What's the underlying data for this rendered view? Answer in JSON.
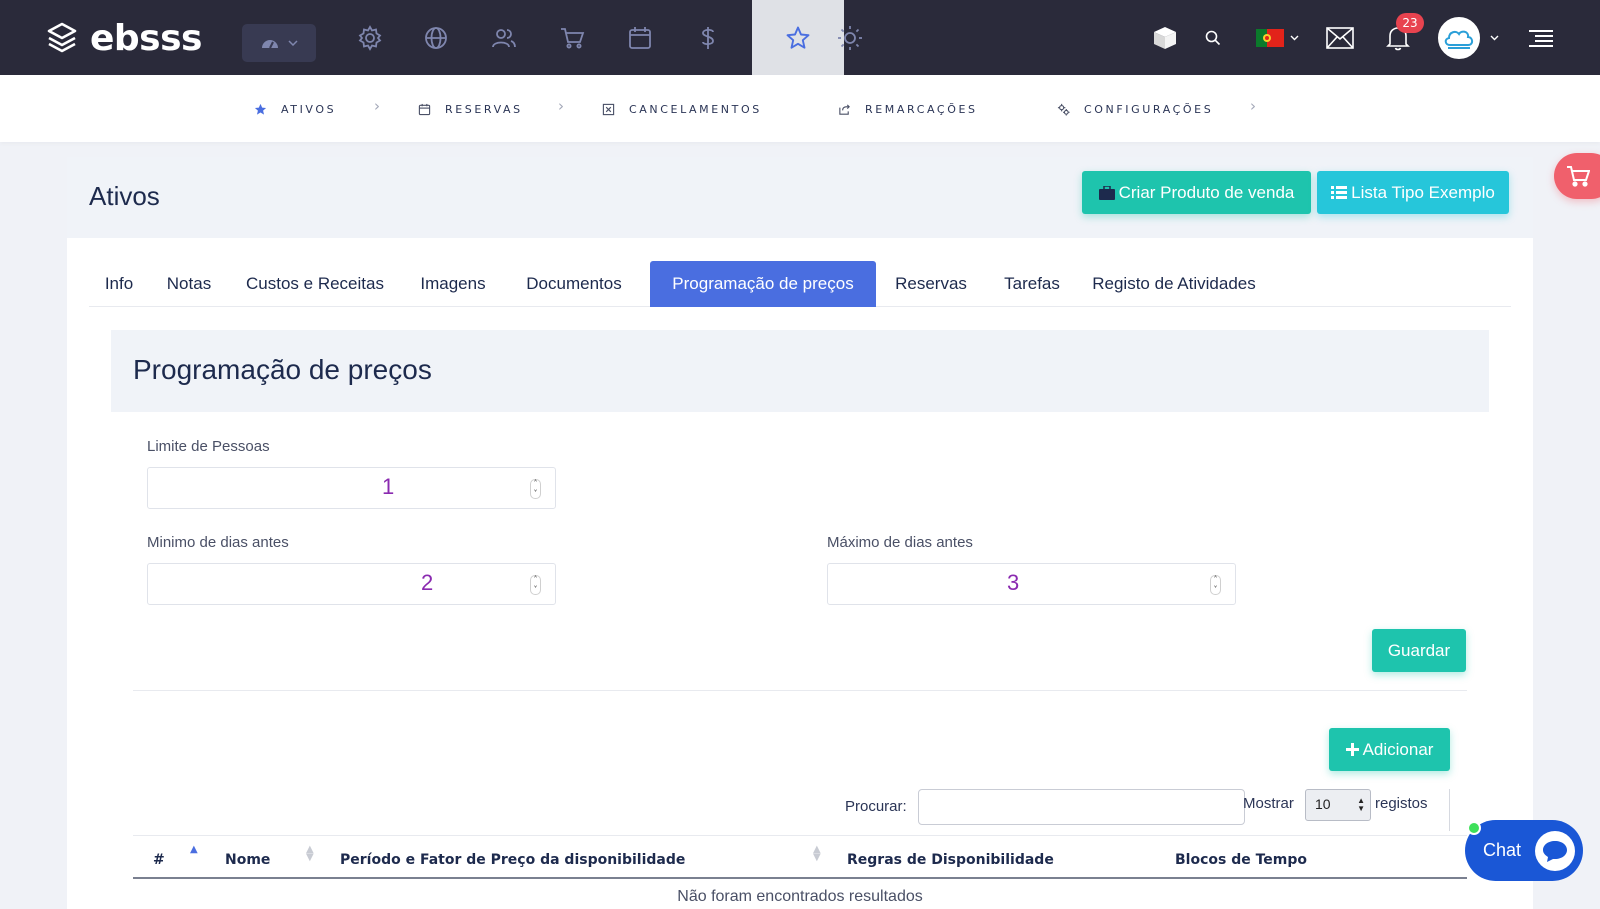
{
  "brand": {
    "name": "ebsss"
  },
  "topnav": {
    "icons": [
      "dashboard-icon",
      "gear-icon",
      "globe-icon",
      "users-icon",
      "cart-icon",
      "calendar-icon",
      "dollar-icon",
      "star-icon",
      "sun-icon"
    ],
    "active": "star-icon",
    "notifications_count": "23",
    "language": "pt"
  },
  "subnav": {
    "items": [
      {
        "label": "ATIVOS",
        "icon": "star-icon"
      },
      {
        "label": "RESERVAS",
        "icon": "calendar-icon"
      },
      {
        "label": "CANCELAMENTOS",
        "icon": "cancel-box-icon"
      },
      {
        "label": "REMARCAÇÕES",
        "icon": "share-icon"
      },
      {
        "label": "CONFIGURAÇÕES",
        "icon": "cogs-icon"
      }
    ]
  },
  "page": {
    "title": "Ativos",
    "buttons": {
      "create_product": "Criar Produto de venda",
      "list_type": "Lista Tipo Exemplo"
    }
  },
  "tabs": {
    "items": [
      "Info",
      "Notas",
      "Custos e Receitas",
      "Imagens",
      "Documentos",
      "Programação de preços",
      "Reservas",
      "Tarefas",
      "Registo de Atividades"
    ],
    "active": "Programação de preços"
  },
  "section": {
    "title": "Programação de preços",
    "fields": {
      "people_limit": {
        "label": "Limite de Pessoas",
        "value": "1"
      },
      "min_days": {
        "label": "Minimo de dias antes",
        "value": "2"
      },
      "max_days": {
        "label": "Máximo de dias antes",
        "value": "3"
      }
    },
    "save_label": "Guardar",
    "add_label": "Adicionar"
  },
  "table": {
    "search_label": "Procurar:",
    "search_value": "",
    "show_label": "Mostrar",
    "page_size": "10",
    "records_label": "registos",
    "columns": [
      "#",
      "Nome",
      "Período e Fator de Preço da disponibilidade",
      "Regras de Disponibilidade",
      "Blocos de Tempo"
    ],
    "empty_message": "Não foram encontrados resultados"
  },
  "chat": {
    "label": "Chat"
  },
  "colors": {
    "topbar": "#2a2a3a",
    "accent_teal": "#1ec4ad",
    "accent_cyan": "#26c6da",
    "tab_active": "#4a6ee0",
    "nav_icon": "#7f86ae",
    "chat": "#1a57d6"
  }
}
